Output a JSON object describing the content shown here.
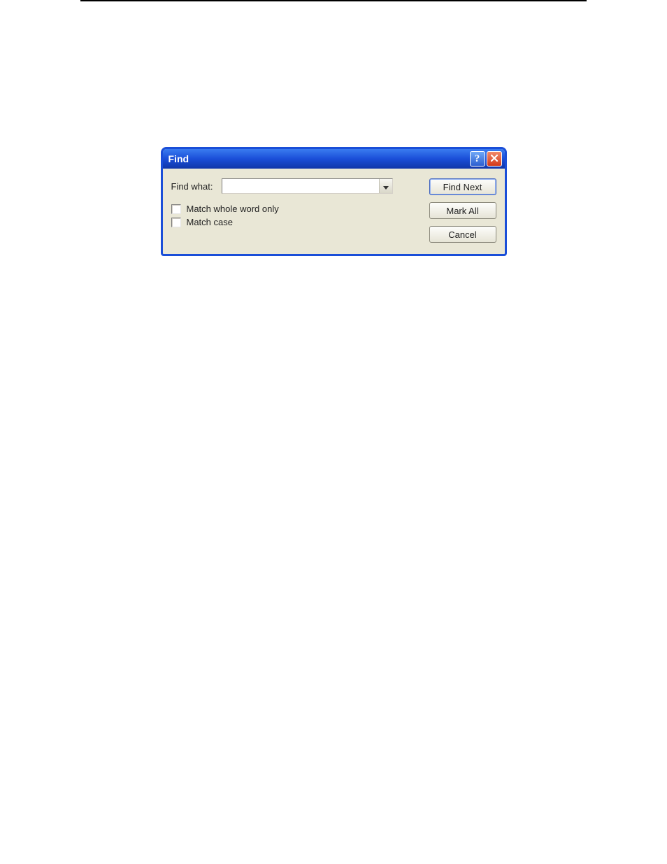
{
  "dialog": {
    "title": "Find",
    "findWhatLabel": "Find what:",
    "findWhatValue": "",
    "matchWholeWordLabel": "Match whole word only",
    "matchCaseLabel": "Match case",
    "buttons": {
      "findNext": "Find Next",
      "markAll": "Mark All",
      "cancel": "Cancel"
    },
    "helpGlyph": "?"
  }
}
